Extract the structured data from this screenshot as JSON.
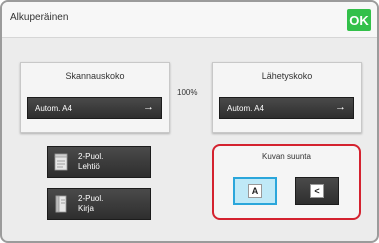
{
  "header": {
    "title": "Alkuperäinen",
    "ok_label": "OK"
  },
  "scan_size": {
    "title": "Skannauskoko",
    "value": "Autom. A4"
  },
  "ratio": {
    "value": "100%"
  },
  "send_size": {
    "title": "Lähetyskoko",
    "value": "Autom. A4"
  },
  "duplex": [
    {
      "line1": "2-Puol.",
      "line2": "Lehtiö"
    },
    {
      "line1": "2-Puol.",
      "line2": "Kirja"
    }
  ],
  "orientation": {
    "title": "Kuvan suunta",
    "options": [
      {
        "glyph": "A",
        "selected": true
      },
      {
        "glyph": "<",
        "selected": false
      }
    ]
  },
  "colors": {
    "ok": "#33c04a",
    "highlight": "#d4222f",
    "selected": "#2aa6db"
  }
}
